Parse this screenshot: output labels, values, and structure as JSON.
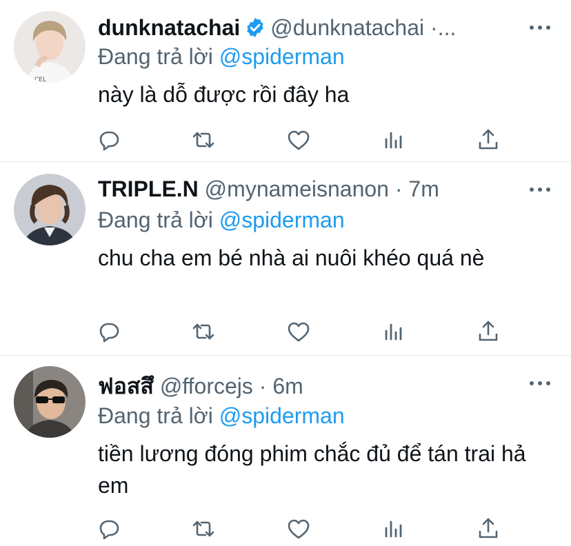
{
  "icon_color": "#536471",
  "accent": "#1d9bf0",
  "tweets": [
    {
      "name": "dunknatachai",
      "verified": true,
      "handle": "@dunknatachai ·...",
      "reply_prefix": "Đang trả lời",
      "reply_to": "@spiderman",
      "text": "này là dỗ được rồi đây ha"
    },
    {
      "name": "TRIPLE.N",
      "verified": false,
      "handle": "@mynameisnanon · 7m",
      "reply_prefix": "Đang trả lời",
      "reply_to": "@spiderman",
      "text": "chu cha em bé nhà ai nuôi khéo quá nè"
    },
    {
      "name": "ฟอสสึ",
      "verified": false,
      "handle": "@fforcejs · 6m",
      "reply_prefix": "Đang trả lời",
      "reply_to": "@spiderman",
      "text": "tiền lương đóng phim chắc đủ để tán trai hả em"
    }
  ],
  "icons": [
    "reply-icon",
    "retweet-icon",
    "like-icon",
    "stats-icon",
    "share-icon",
    "more-icon",
    "verified-badge-icon"
  ]
}
